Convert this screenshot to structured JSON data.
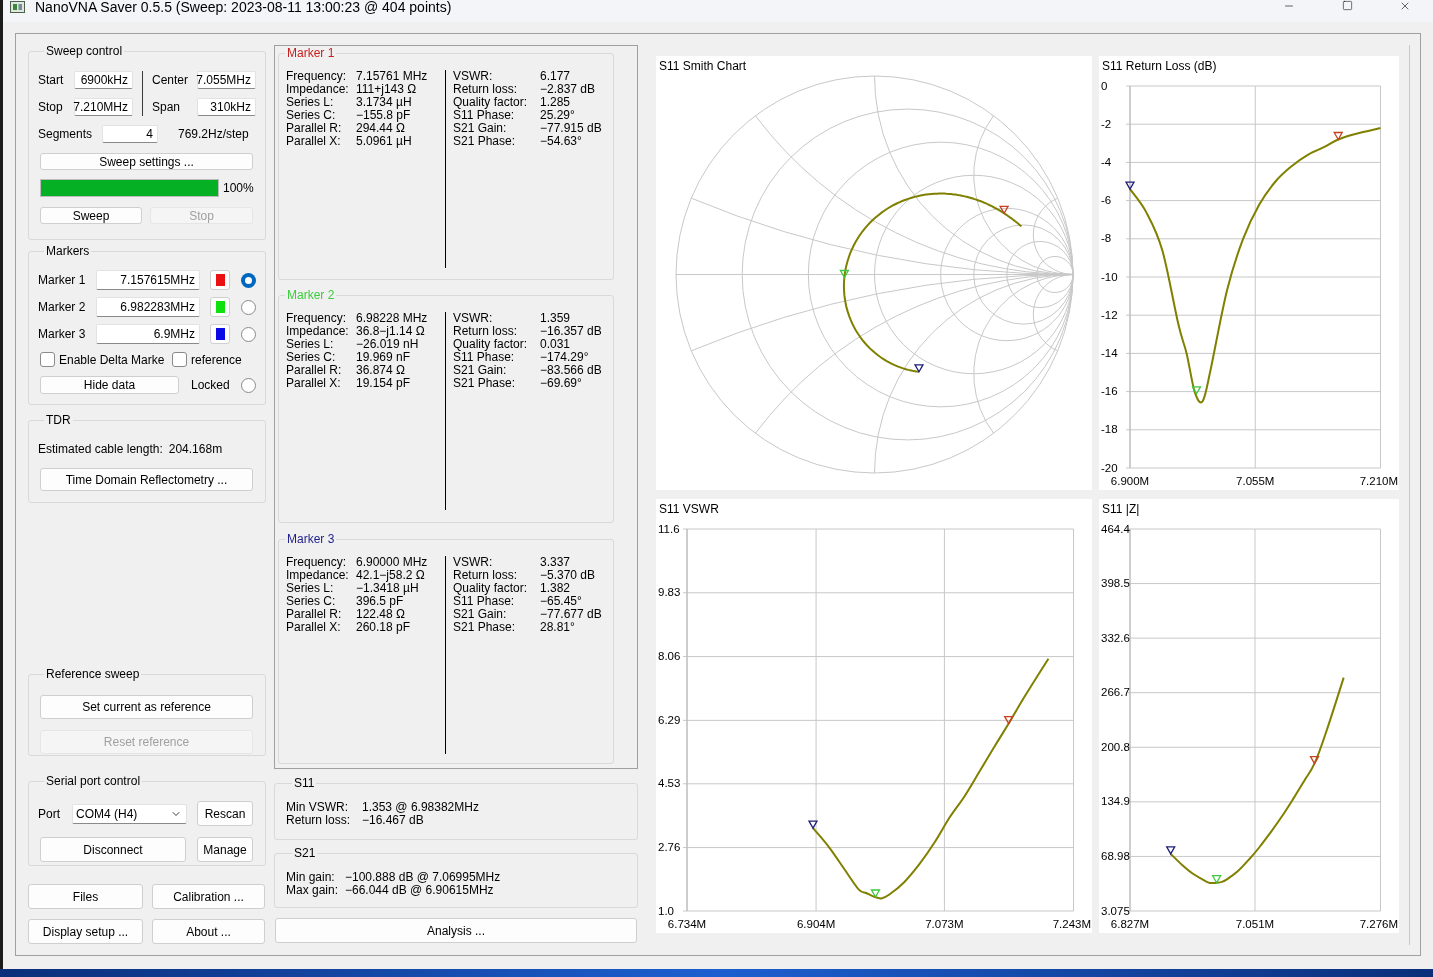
{
  "window": {
    "title": "NanoVNA Saver 0.5.5 (Sweep: 2023-08-11 13:00:23 @ 404 points)"
  },
  "sweep_control": {
    "title": "Sweep control",
    "fields": [
      {
        "label": "Start",
        "value": "6900kHz"
      },
      {
        "label": "Center",
        "value": "7.055MHz"
      },
      {
        "label": "Stop",
        "value": "7.210MHz"
      },
      {
        "label": "Span",
        "value": "310kHz"
      }
    ],
    "segments": {
      "label": "Segments",
      "value": "4"
    },
    "step": "769.2Hz/step",
    "settings_button": "Sweep settings ...",
    "progress": {
      "level": 1,
      "reading": "100%"
    },
    "buttons": [
      {
        "label": "Sweep",
        "disabled": false
      },
      {
        "label": "Stop",
        "disabled": true
      }
    ]
  },
  "markers_group": {
    "title": "Markers",
    "markers": [
      {
        "label": "Marker 1",
        "value": "7.157615MHz",
        "color": "#e81010",
        "selected": true
      },
      {
        "label": "Marker 2",
        "value": "6.982283MHz",
        "color": "#10e010",
        "selected": false
      },
      {
        "label": "Marker 3",
        "value": "6.9MHz",
        "color": "#0a0ae6",
        "selected": false
      }
    ],
    "checkboxes": [
      {
        "label": "Enable Delta Marke",
        "checked": false
      },
      {
        "label": "reference",
        "checked": false
      }
    ],
    "hide_button": "Hide data",
    "locked": {
      "label": "Locked",
      "checked": false
    }
  },
  "tdr": {
    "title": "TDR",
    "label": "Estimated cable length:",
    "value": "204.168m",
    "button": "Time Domain Reflectometry ..."
  },
  "reference_sweep": {
    "title": "Reference sweep",
    "buttons": [
      {
        "label": "Set current as reference",
        "disabled": false
      },
      {
        "label": "Reset reference",
        "disabled": true
      }
    ]
  },
  "serial_port": {
    "title": "Serial port control",
    "port_label": "Port",
    "port_value": "COM4 (H4)",
    "rescan_button": "Rescan",
    "connect_button": "Disconnect",
    "manage_button": "Manage"
  },
  "bottom_buttons": [
    "Files",
    "Calibration ...",
    "Display setup ...",
    "About ..."
  ],
  "marker_panels": [
    {
      "title": "Marker 1",
      "color": "#c81e1e",
      "left": [
        {
          "label": "Frequency:",
          "value": "7.15761 MHz"
        },
        {
          "label": "Impedance:",
          "value": "111+j143 Ω"
        },
        {
          "label": "Series L:",
          "value": "3.1734 µH"
        },
        {
          "label": "Series C:",
          "value": "−155.8 pF"
        },
        {
          "label": "Parallel R:",
          "value": "294.44 Ω"
        },
        {
          "label": "Parallel X:",
          "value": "5.0961 µH"
        }
      ],
      "right": [
        {
          "label": "VSWR:",
          "value": "6.177"
        },
        {
          "label": "Return loss:",
          "value": "−2.837 dB"
        },
        {
          "label": "Quality factor:",
          "value": "1.285"
        },
        {
          "label": "S11 Phase:",
          "value": "25.29°"
        },
        {
          "label": "S21 Gain:",
          "value": "−77.915 dB"
        },
        {
          "label": "S21 Phase:",
          "value": "−54.63°"
        }
      ]
    },
    {
      "title": "Marker 2",
      "color": "#3ccd3c",
      "left": [
        {
          "label": "Frequency:",
          "value": "6.98228 MHz"
        },
        {
          "label": "Impedance:",
          "value": "36.8−j1.14 Ω"
        },
        {
          "label": "Series L:",
          "value": "−26.019 nH"
        },
        {
          "label": "Series C:",
          "value": "19.969 nF"
        },
        {
          "label": "Parallel R:",
          "value": "36.874 Ω"
        },
        {
          "label": "Parallel X:",
          "value": "19.154 pF"
        }
      ],
      "right": [
        {
          "label": "VSWR:",
          "value": "1.359"
        },
        {
          "label": "Return loss:",
          "value": "−16.357 dB"
        },
        {
          "label": "Quality factor:",
          "value": "0.031"
        },
        {
          "label": "S11 Phase:",
          "value": "−174.29°"
        },
        {
          "label": "S21 Gain:",
          "value": "−83.566 dB"
        },
        {
          "label": "S21 Phase:",
          "value": "−69.69°"
        }
      ]
    },
    {
      "title": "Marker 3",
      "color": "#1e1e8c",
      "left": [
        {
          "label": "Frequency:",
          "value": "6.90000 MHz"
        },
        {
          "label": "Impedance:",
          "value": "42.1−j58.2 Ω"
        },
        {
          "label": "Series L:",
          "value": "−1.3418 µH"
        },
        {
          "label": "Series C:",
          "value": "396.5 pF"
        },
        {
          "label": "Parallel R:",
          "value": "122.48 Ω"
        },
        {
          "label": "Parallel X:",
          "value": "260.18 pF"
        }
      ],
      "right": [
        {
          "label": "VSWR:",
          "value": "3.337"
        },
        {
          "label": "Return loss:",
          "value": "−5.370 dB"
        },
        {
          "label": "Quality factor:",
          "value": "1.382"
        },
        {
          "label": "S11 Phase:",
          "value": "−65.45°"
        },
        {
          "label": "S21 Gain:",
          "value": "−77.677 dB"
        },
        {
          "label": "S21 Phase:",
          "value": "28.81°"
        }
      ]
    }
  ],
  "s11_summary": {
    "title": "S11",
    "rows": [
      {
        "label": "Min VSWR:",
        "value": "1.353 @ 6.98382MHz"
      },
      {
        "label": "Return loss:",
        "value": "−16.467 dB"
      }
    ]
  },
  "s21_summary": {
    "title": "S21",
    "rows": [
      {
        "label": "Min gain:",
        "value": "−100.888 dB @ 7.06995MHz"
      },
      {
        "label": "Max gain:",
        "value": "−66.044 dB @ 6.90615MHz"
      }
    ]
  },
  "analysis_button": "Analysis ...",
  "charts": [
    {
      "kind": "smith",
      "title": "S11 Smith Chart",
      "markers": [
        {
          "color": "#c8401e"
        },
        {
          "color": "#3cc83c"
        },
        {
          "color": "#1e1e78"
        }
      ]
    },
    {
      "kind": "line",
      "markers": [
        {
          "color": "#c8401e"
        },
        {
          "color": "#3cc83c"
        },
        {
          "color": "#1e1e78"
        }
      ],
      "chart_data": {
        "type": "line",
        "title": "S11 Return Loss (dB)",
        "x": [
          6.9,
          6.92,
          6.94,
          6.96,
          6.97,
          6.98,
          6.99,
          7.0,
          7.02,
          7.04,
          7.06,
          7.08,
          7.1,
          7.12,
          7.14,
          7.1576,
          7.18,
          7.21
        ],
        "values": [
          -5.4,
          -6.6,
          -8.6,
          -12.5,
          -14.0,
          -16.0,
          -16.5,
          -14.8,
          -10.7,
          -8.0,
          -6.2,
          -5.0,
          -4.2,
          -3.6,
          -3.2,
          -2.8,
          -2.5,
          -2.2
        ],
        "xlim": [
          6.9,
          7.21
        ],
        "ylim": [
          -20,
          0
        ],
        "grid": true,
        "xticks": [
          {
            "value": 6.9,
            "label": "6.900M"
          },
          {
            "value": 7.055,
            "label": "7.055M"
          },
          {
            "value": 7.21,
            "label": "7.210M"
          }
        ],
        "yticks": [
          0,
          -2,
          -4,
          -6,
          -8,
          -10,
          -12,
          -14,
          -16,
          -18,
          -20
        ]
      }
    },
    {
      "kind": "line",
      "markers": [
        {
          "color": "#c8401e"
        },
        {
          "color": "#3cc83c"
        },
        {
          "color": "#1e1e78"
        }
      ],
      "chart_data": {
        "type": "line",
        "title": "S11 VSWR",
        "x": [
          6.9,
          6.92,
          6.94,
          6.96,
          6.97,
          6.98,
          6.99,
          7.0,
          7.02,
          7.04,
          7.06,
          7.08,
          7.1,
          7.12,
          7.14,
          7.1576,
          7.18,
          7.21
        ],
        "values": [
          3.3,
          2.8,
          2.2,
          1.6,
          1.5,
          1.4,
          1.35,
          1.45,
          1.8,
          2.3,
          2.9,
          3.6,
          4.2,
          4.9,
          5.6,
          6.2,
          7.0,
          8.0
        ],
        "xlim": [
          6.734,
          7.243
        ],
        "ylim": [
          1.0,
          11.6
        ],
        "grid": true,
        "xticks": [
          {
            "value": 6.734,
            "label": "6.734M"
          },
          {
            "value": 6.904,
            "label": "6.904M"
          },
          {
            "value": 7.073,
            "label": "7.073M"
          },
          {
            "value": 7.243,
            "label": "7.243M"
          }
        ],
        "yticks": [
          {
            "value": 11.6,
            "label": "11.6"
          },
          {
            "value": 9.83,
            "label": "9.83"
          },
          {
            "value": 8.06,
            "label": "8.06"
          },
          {
            "value": 6.29,
            "label": "6.29"
          },
          {
            "value": 4.53,
            "label": "4.53"
          },
          {
            "value": 2.76,
            "label": "2.76"
          },
          {
            "value": 1.0,
            "label": "1.0"
          }
        ]
      }
    },
    {
      "kind": "line",
      "markers": [
        {
          "color": "#c8401e"
        },
        {
          "color": "#3cc83c"
        },
        {
          "color": "#1e1e78"
        }
      ],
      "chart_data": {
        "type": "line",
        "title": "S11 |Z|",
        "x": [
          6.9,
          6.92,
          6.94,
          6.96,
          6.97,
          6.98,
          6.99,
          7.0,
          7.02,
          7.04,
          7.06,
          7.08,
          7.1,
          7.12,
          7.14,
          7.1576,
          7.18,
          7.21
        ],
        "values": [
          72,
          59,
          48,
          40,
          37,
          37,
          38,
          41,
          51,
          65,
          81,
          99,
          118,
          139,
          161,
          181,
          222,
          285
        ],
        "xlim": [
          6.827,
          7.276
        ],
        "ylim": [
          3.075,
          464.4
        ],
        "grid": true,
        "xticks": [
          {
            "value": 6.827,
            "label": "6.827M"
          },
          {
            "value": 7.051,
            "label": "7.051M"
          },
          {
            "value": 7.276,
            "label": "7.276M"
          }
        ],
        "yticks": [
          {
            "value": 464.4,
            "label": "464.4"
          },
          {
            "value": 398.5,
            "label": "398.5"
          },
          {
            "value": 332.6,
            "label": "332.6"
          },
          {
            "value": 266.7,
            "label": "266.7"
          },
          {
            "value": 200.8,
            "label": "200.8"
          },
          {
            "value": 134.9,
            "label": "134.9"
          },
          {
            "value": 68.98,
            "label": "68.98"
          },
          {
            "value": 3.075,
            "label": "3.075"
          }
        ]
      }
    }
  ]
}
